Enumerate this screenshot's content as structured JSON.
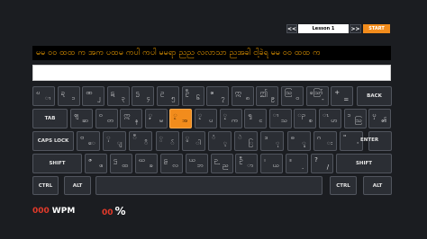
{
  "lesson_nav": {
    "prev_label": "<<",
    "lesson_label": "Lesson 1",
    "next_label": ">>",
    "start_label": "START"
  },
  "practice_text": "မမ ၀၀ ထထ က အက ပထမ ကပါ ကပါ မမရာ ညည လလာသာ ညအခါ ငါ့ခဲရ မမ ၀၀ ထထ က",
  "input": {
    "value": ""
  },
  "keyboard": {
    "row1": [
      {
        "tl": "ဎ",
        "br": "ၢ"
      },
      {
        "tl": "ဍ",
        "br": "၁"
      },
      {
        "tl": "ဏ",
        "br": "၂"
      },
      {
        "tl": "ဋ",
        "br": "၃"
      },
      {
        "tl": "ဌ",
        "br": "၄"
      },
      {
        "tl": "ဥ",
        "br": "၅"
      },
      {
        "tl": "ဦ",
        "br": "၆"
      },
      {
        "tl": "ဧ",
        "br": "၇"
      },
      {
        "tl": "ဣ",
        "br": "၈"
      },
      {
        "tl": "ဤ",
        "br": "၉"
      },
      {
        "tl": "ဩ",
        "br": "၀"
      },
      {
        "tl": "ဪ",
        "br": "-"
      },
      {
        "tl": "+",
        "br": "="
      }
    ],
    "backspace": "BACK",
    "tab": "TAB",
    "row2": [
      {
        "tl": "ဈ",
        "br": "ဆ"
      },
      {
        "tl": "ဝ",
        "br": "တ"
      },
      {
        "tl": "ဣ",
        "br": "န"
      },
      {
        "tl": "ၞ",
        "br": "မ"
      },
      {
        "tl": "ၟ",
        "br": "အ"
      },
      {
        "tl": "ၟ",
        "br": "ပ"
      },
      {
        "tl": "ၠ",
        "br": "က"
      },
      {
        "tl": "ၡ",
        "br": "င"
      },
      {
        "tl": "ၢ",
        "br": "သ"
      },
      {
        "tl": "ၣ",
        "br": "စ"
      },
      {
        "tl": "ၤ",
        "br": "ဟ"
      },
      {
        "tl": "ၥ",
        "br": "ဩ"
      },
      {
        "tl": "ၦ",
        "br": "၏"
      }
    ],
    "caps": "CAPS LOCK",
    "row3": [
      {
        "tl": "ဗ",
        "br": "ေ"
      },
      {
        "tl": "ှ",
        "br": "ျ"
      },
      {
        "tl": "ီ",
        "br": "ိ"
      },
      {
        "tl": "္",
        "br": "်"
      },
      {
        "tl": "ွ",
        "br": "ါ"
      },
      {
        "tl": "ံ",
        "br": "့"
      },
      {
        "tl": "ဲ",
        "br": "ြ"
      },
      {
        "tl": "ဒ",
        "br": "ု"
      },
      {
        "tl": "ဓ",
        "br": "ူ"
      },
      {
        "tl": "ဂ",
        "br": "း"
      },
      {
        "tl": "\"",
        "br": "'"
      }
    ],
    "enter": "ENTER",
    "shift_left": "SHIFT",
    "row4": [
      {
        "tl": "ဇ",
        "br": "ဖ"
      },
      {
        "tl": "ဌ",
        "br": "ထ"
      },
      {
        "tl": "ဃ",
        "br": "ခ"
      },
      {
        "tl": "ဠ",
        "br": "လ"
      },
      {
        "tl": "ယ",
        "br": "ဘ"
      },
      {
        "tl": "ဉ",
        "br": "ည"
      },
      {
        "tl": "ဦ",
        "br": "ာ"
      },
      {
        "tl": "၊",
        "br": "ယ"
      },
      {
        "tl": "။",
        "br": "."
      },
      {
        "tl": "?",
        "br": "/"
      }
    ],
    "shift_right": "SHIFT",
    "ctrl_left": "CTRL",
    "alt_left": "ALT",
    "ctrl_right": "CTRL",
    "alt_right": "ALT"
  },
  "stats": {
    "wpm_value": "000",
    "wpm_label": "WPM",
    "accuracy_value": "00",
    "accuracy_label": "%"
  },
  "colors": {
    "accent": "#f28c1c",
    "practice_text": "#f2a000",
    "stat_value": "#e23a2a"
  }
}
